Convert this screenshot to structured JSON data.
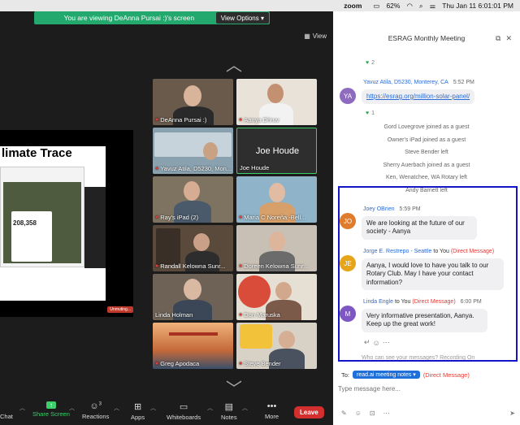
{
  "menubar": {
    "app": "zoom",
    "battery": "62%",
    "datetime": "Thu Jan 11  6:01:01 PM"
  },
  "banner": {
    "text": "You are viewing DeAnna Pursai :)'s screen",
    "options": "View Options"
  },
  "view_label": "View",
  "slide": {
    "title": "limate Trace",
    "stat": "208,358",
    "unmute": "Unmuting..."
  },
  "gallery": [
    {
      "name": "DeAnna Pursai :)"
    },
    {
      "name": "Aanya Dhruv"
    },
    {
      "name": "Yavuz Atila, D5230, Mon..."
    },
    {
      "name": "Joe Houde",
      "display": "Joe Houde"
    },
    {
      "name": "Ray's iPad (2)"
    },
    {
      "name": "Maria C Noreña -Bell..."
    },
    {
      "name": "Randall Kelowna Sunr..."
    },
    {
      "name": "Doreen Kelowna Sunr..."
    },
    {
      "name": "Linda Holman"
    },
    {
      "name": "Don Maruska"
    },
    {
      "name": "Greg Apodaca"
    },
    {
      "name": "Steve Bender"
    }
  ],
  "toolbar": {
    "chat": "Chat",
    "share": "Share Screen",
    "reactions": "Reactions",
    "reactions_count": "3",
    "apps": "Apps",
    "whiteboards": "Whiteboards",
    "notes": "Notes",
    "more": "More",
    "leave": "Leave"
  },
  "chat": {
    "title": "ESRAG Monthly Meeting",
    "top_reaction_count": "2",
    "yavuz": {
      "initials": "YA",
      "name": "Yavuz Atila, D5230, Monterey, CA",
      "time": "5:52 PM",
      "link": "https://esrag.org/million-solar-panel/",
      "reaction_count": "1"
    },
    "system": [
      "Gord Lovegrove joined as a guest",
      "Owner's iPad joined as a guest",
      "Steve Bender left",
      "Sherry Auerbach joined as a guest",
      "Ken, Wenatchee, WA Rotary left",
      "Andy Barnett left"
    ],
    "joey": {
      "initials": "JO",
      "name": "Joey OBrien",
      "time": "5:59 PM",
      "text": "We are looking at the future of our society - Aanya"
    },
    "jorge": {
      "initials": "JE",
      "name": "Jorge E. Restrepo - Seattle",
      "to": "to You",
      "dm": "(Direct Message)",
      "text": "Aanya, I would love to have you talk to our Rotary Club.  May I have your contact information?"
    },
    "linda": {
      "initials": "M",
      "name": "Linda Engle",
      "to": "to You",
      "dm": "(Direct Message)",
      "time": "6:00 PM",
      "text": "Very informative presentation, Aanya. Keep up the great work!"
    },
    "who_can_see": "Who can see your messages? Recording On",
    "to_label": "To:",
    "recipient": "read.ai meeting notes",
    "recipient_dm": "(Direct Message)",
    "placeholder": "Type message here..."
  },
  "colors": {
    "banner": "#23a86e",
    "leave": "#d32f2f",
    "highlight": "#1414c8",
    "link": "#2b6bd6"
  }
}
